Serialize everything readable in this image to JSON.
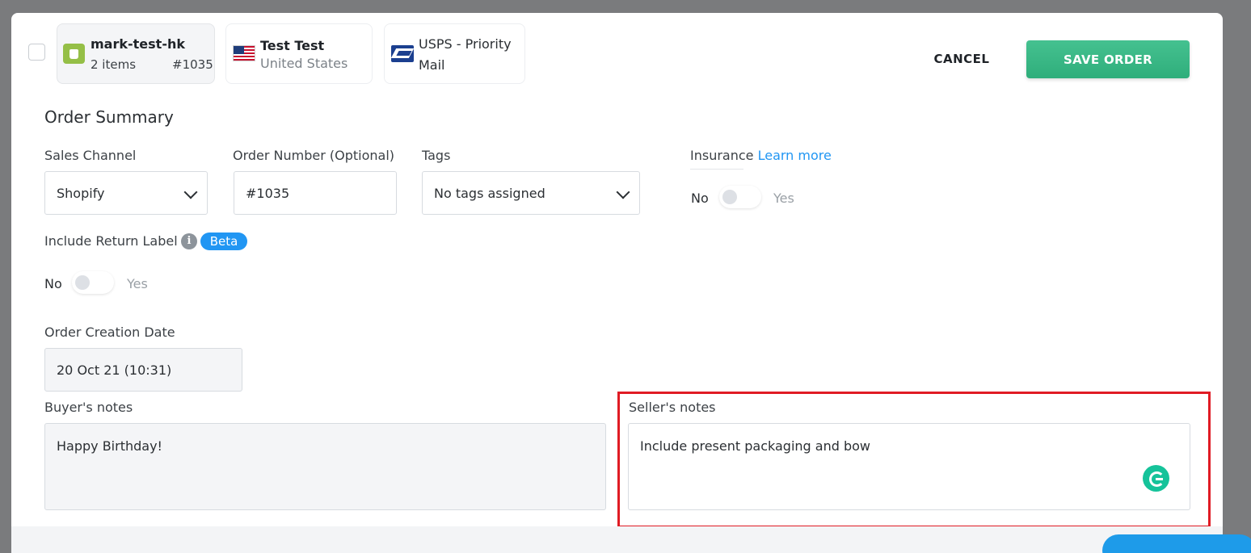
{
  "order_card": {
    "store_name": "mark-test-hk",
    "items": "2 items",
    "order_number": "#1035",
    "buyer_name": "Test Test",
    "buyer_country": "United States",
    "shipping_line1": "USPS - Priority",
    "shipping_line2": "Mail",
    "store_icon": "shopify-icon",
    "country_icon": "us-flag-icon",
    "carrier_icon": "usps-icon"
  },
  "actions": {
    "cancel_label": "CANCEL",
    "save_label": "SAVE ORDER",
    "save_color": "#3ab886"
  },
  "summary": {
    "title": "Order Summary",
    "sales_channel_label": "Sales Channel",
    "sales_channel_value": "Shopify",
    "order_number_label": "Order Number (Optional)",
    "order_number_value": "#1035",
    "tags_label": "Tags",
    "tags_value": "No tags assigned",
    "insurance_label": "Insurance",
    "insurance_link": "Learn more",
    "insurance_no": "No",
    "insurance_yes": "Yes",
    "insurance_enabled": false,
    "return_label_label": "Include Return Label",
    "return_beta": "Beta",
    "return_no": "No",
    "return_yes": "Yes",
    "return_enabled": false,
    "creation_date_label": "Order Creation Date",
    "creation_date_value": "20 Oct 21 (10:31)",
    "buyer_notes_label": "Buyer's notes",
    "buyer_notes_value": "Happy Birthday!",
    "seller_notes_label": "Seller's notes",
    "seller_notes_value": "Include present packaging and bow",
    "accent_color": "#2196f3",
    "highlight_color": "#e01b24"
  }
}
